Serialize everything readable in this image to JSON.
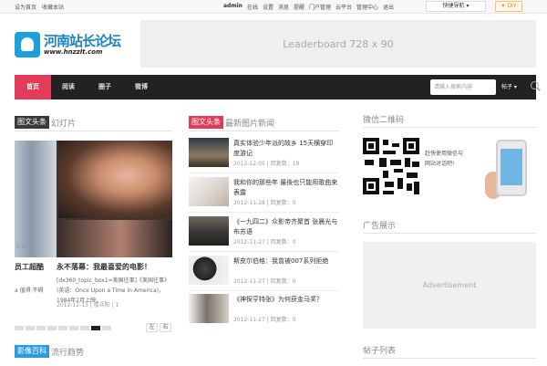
{
  "topbar": {
    "set_home": "设为首页",
    "bookmark": "收藏本站",
    "user": "admin",
    "links": [
      "在线",
      "设置",
      "消息",
      "提醒",
      "门户管理",
      "云平台",
      "管理中心",
      "退出"
    ],
    "quicknav": "快捷导航",
    "diy": "DIY"
  },
  "header": {
    "logo_cn": "河南站长论坛",
    "logo_en": "www.hnzzlt.com",
    "leaderboard": "Leaderboard 728 x 90"
  },
  "nav": {
    "items": [
      "首页",
      "阅读",
      "圈子",
      "微博"
    ],
    "search_placeholder": "请输入搜索内容",
    "search_scope": "帖子",
    "colors": {
      "bar": "#222222",
      "active": "#e33b5a"
    }
  },
  "left": {
    "tag": "图文头条",
    "sub": "幻灯片",
    "slide_watermark": "ℰ Q",
    "caption_left_title": "员工超酷",
    "caption_left_body": "a 值得 不碍",
    "caption_title": "永不落幕：我最喜爱的电影！",
    "caption_body": "[dx360_topic_box1=美国往事]《美国往事》(英语：Once Upon a Time in America)，1984年2月上映。...",
    "caption_meta": "2012-12-13 | 楼众阳 | 1",
    "arrow_left": "左",
    "arrow_right": "右"
  },
  "middle": {
    "tag": "图文头条",
    "sub": "最新图片新闻",
    "news": [
      {
        "title": "真实体验少年派的故乡 15天横穿印度游记",
        "meta": "2012-12-05 | 回复数：19"
      },
      {
        "title": "我和你的那些年 最後也只能用歌曲来表露",
        "meta": "2012-11-28 | 回复数：0"
      },
      {
        "title": "《一九四二》众影帝齐聚首 张晨光与布苏语",
        "meta": "2012-11-27 | 回复数：0"
      },
      {
        "title": "斯皮尔伯格：我曾被007系列拒绝",
        "meta": "2012-11-27 | 回复数：0"
      },
      {
        "title": "《神探亨特张》为何获金马奖？",
        "meta": "2012-11-27 | 回复数：0"
      }
    ]
  },
  "bottom": {
    "tag": "影像百科",
    "sub": "流行趋势"
  },
  "right": {
    "qr_heading": "微信二维码",
    "qr_text_1": "赶快使用微信与",
    "qr_text_2": "网站对话吧!",
    "ad_heading": "广告展示",
    "ad_text": "Advertisement",
    "posts_heading": "帖子列表"
  }
}
